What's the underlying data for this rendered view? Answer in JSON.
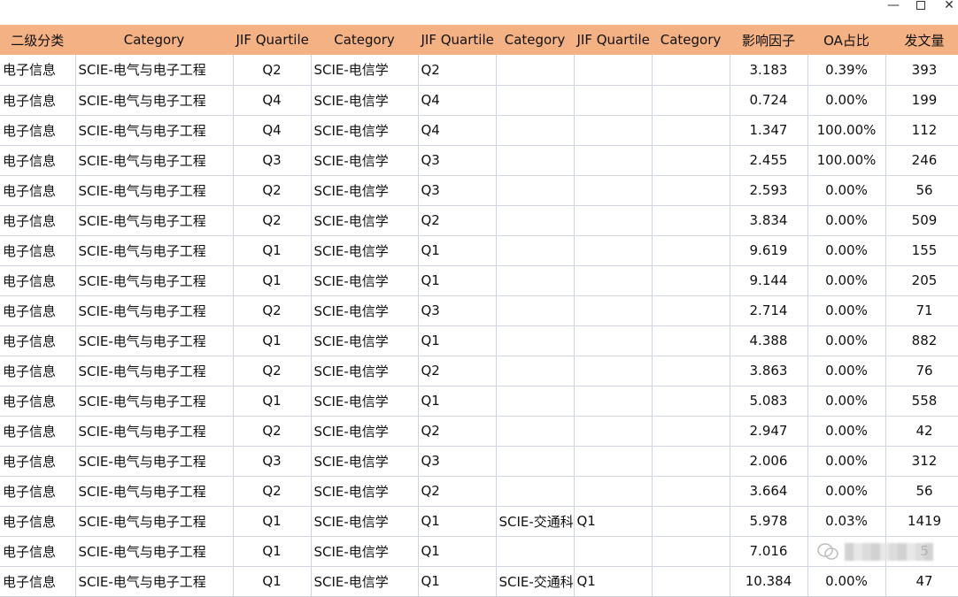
{
  "window": {
    "minimize_glyph": "—",
    "close_glyph": "✕"
  },
  "headers": [
    "二级分类",
    "Category",
    "JIF Quartile",
    "Category",
    "JIF Quartile",
    "Category",
    "JIF Quartile",
    "Category",
    "影响因子",
    "OA占比",
    "发文量"
  ],
  "rows": [
    [
      "电子信息",
      "SCIE-电气与电子工程",
      "Q2",
      "SCIE-电信学",
      "Q2",
      "",
      "",
      "",
      "3.183",
      "0.39%",
      "393"
    ],
    [
      "电子信息",
      "SCIE-电气与电子工程",
      "Q4",
      "SCIE-电信学",
      "Q4",
      "",
      "",
      "",
      "0.724",
      "0.00%",
      "199"
    ],
    [
      "电子信息",
      "SCIE-电气与电子工程",
      "Q4",
      "SCIE-电信学",
      "Q4",
      "",
      "",
      "",
      "1.347",
      "100.00%",
      "112"
    ],
    [
      "电子信息",
      "SCIE-电气与电子工程",
      "Q3",
      "SCIE-电信学",
      "Q3",
      "",
      "",
      "",
      "2.455",
      "100.00%",
      "246"
    ],
    [
      "电子信息",
      "SCIE-电气与电子工程",
      "Q2",
      "SCIE-电信学",
      "Q3",
      "",
      "",
      "",
      "2.593",
      "0.00%",
      "56"
    ],
    [
      "电子信息",
      "SCIE-电气与电子工程",
      "Q2",
      "SCIE-电信学",
      "Q2",
      "",
      "",
      "",
      "3.834",
      "0.00%",
      "509"
    ],
    [
      "电子信息",
      "SCIE-电气与电子工程",
      "Q1",
      "SCIE-电信学",
      "Q1",
      "",
      "",
      "",
      "9.619",
      "0.00%",
      "155"
    ],
    [
      "电子信息",
      "SCIE-电气与电子工程",
      "Q1",
      "SCIE-电信学",
      "Q1",
      "",
      "",
      "",
      "9.144",
      "0.00%",
      "205"
    ],
    [
      "电子信息",
      "SCIE-电气与电子工程",
      "Q2",
      "SCIE-电信学",
      "Q3",
      "",
      "",
      "",
      "2.714",
      "0.00%",
      "71"
    ],
    [
      "电子信息",
      "SCIE-电气与电子工程",
      "Q1",
      "SCIE-电信学",
      "Q1",
      "",
      "",
      "",
      "4.388",
      "0.00%",
      "882"
    ],
    [
      "电子信息",
      "SCIE-电气与电子工程",
      "Q2",
      "SCIE-电信学",
      "Q2",
      "",
      "",
      "",
      "3.863",
      "0.00%",
      "76"
    ],
    [
      "电子信息",
      "SCIE-电气与电子工程",
      "Q1",
      "SCIE-电信学",
      "Q1",
      "",
      "",
      "",
      "5.083",
      "0.00%",
      "558"
    ],
    [
      "电子信息",
      "SCIE-电气与电子工程",
      "Q2",
      "SCIE-电信学",
      "Q2",
      "",
      "",
      "",
      "2.947",
      "0.00%",
      "42"
    ],
    [
      "电子信息",
      "SCIE-电气与电子工程",
      "Q3",
      "SCIE-电信学",
      "Q3",
      "",
      "",
      "",
      "2.006",
      "0.00%",
      "312"
    ],
    [
      "电子信息",
      "SCIE-电气与电子工程",
      "Q2",
      "SCIE-电信学",
      "Q2",
      "",
      "",
      "",
      "3.664",
      "0.00%",
      "56"
    ],
    [
      "电子信息",
      "SCIE-电气与电子工程",
      "Q1",
      "SCIE-电信学",
      "Q1",
      "SCIE-交通科",
      "Q1",
      "",
      "5.978",
      "0.03%",
      "1419"
    ],
    [
      "电子信息",
      "SCIE-电气与电子工程",
      "Q1",
      "SCIE-电信学",
      "Q1",
      "",
      "",
      "",
      "7.016",
      "",
      "5"
    ],
    [
      "电子信息",
      "SCIE-电气与电子工程",
      "Q1",
      "SCIE-电信学",
      "Q1",
      "SCIE-交通科",
      "Q1",
      "",
      "10.384",
      "0.00%",
      "47"
    ]
  ]
}
